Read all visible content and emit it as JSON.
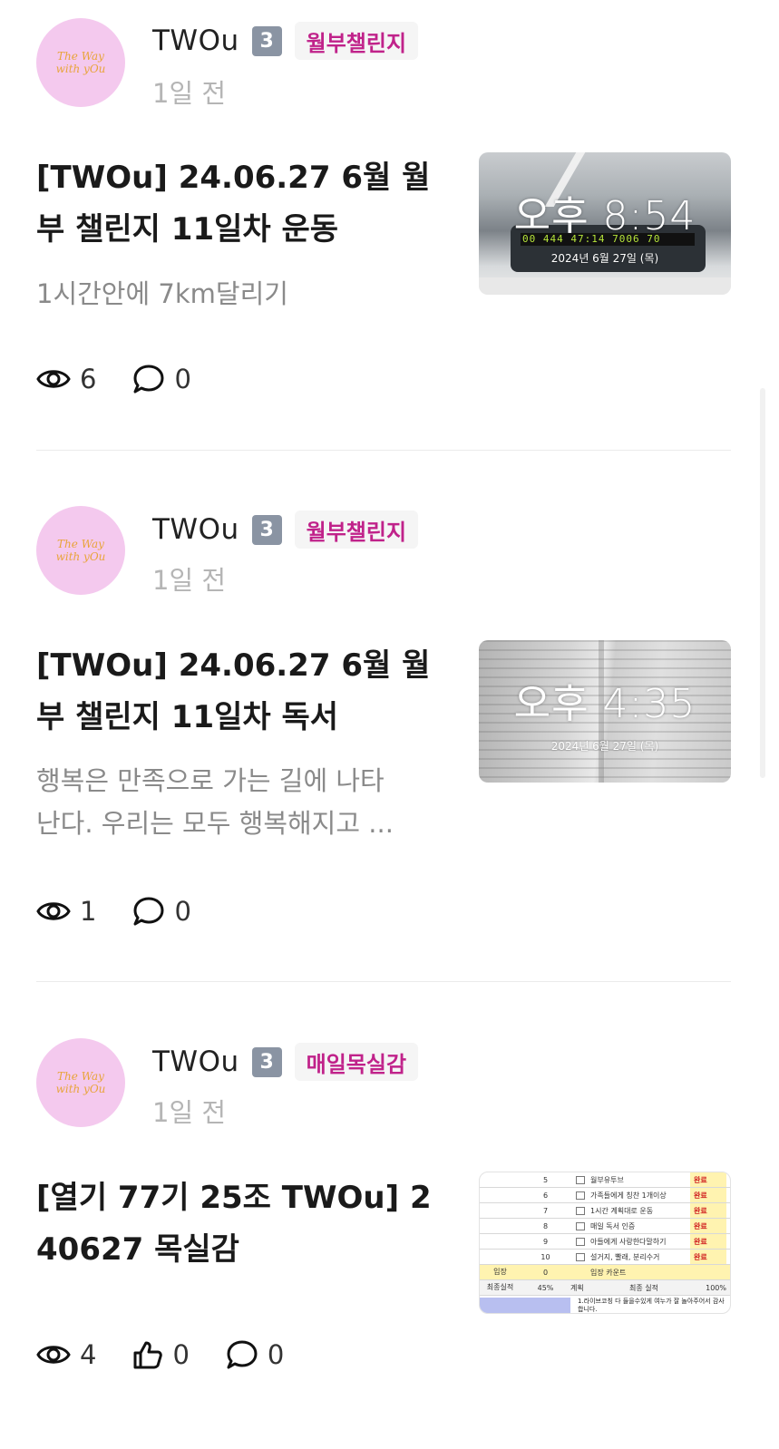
{
  "posts": [
    {
      "author": "TWOu",
      "level": "3",
      "category": "월부챌린지",
      "time": "1일 전",
      "title": "[TWOu] 24.06.27 6월 월\n부 챌린지 11일차 운동",
      "excerpt": "1시간안에 7km달리기",
      "views": "6",
      "comments": "0",
      "thumbnail": {
        "kind": "treadmill-photo",
        "clock": "오후 8:54",
        "date": "2024년 6월 27일 (목)",
        "digits": "00 444 47:14 7006 70"
      }
    },
    {
      "author": "TWOu",
      "level": "3",
      "category": "월부챌린지",
      "time": "1일 전",
      "title": "[TWOu] 24.06.27 6월 월\n부 챌린지 11일차 독서",
      "excerpt": "행복은 만족으로 가는 길에 나타\n난다. 우리는 모두 행복해지고 ...",
      "views": "1",
      "comments": "0",
      "thumbnail": {
        "kind": "book-photo",
        "clock": "오후 4:35",
        "date": "2024년 6월 27일 (목)"
      }
    },
    {
      "author": "TWOu",
      "level": "3",
      "category": "매일목실감",
      "time": "1일 전",
      "title": "[열기 77기 25조 TWOu] 2\n40627 목실감",
      "views": "4",
      "likes": "0",
      "comments": "0",
      "thumbnail": {
        "kind": "spreadsheet",
        "rows": [
          {
            "num": "5",
            "task": "월부유투브",
            "status": "완료"
          },
          {
            "num": "6",
            "task": "가족들에게 칭찬 1개이상",
            "status": "완료"
          },
          {
            "num": "7",
            "task": "1시간 계획대로 운동",
            "status": "완료"
          },
          {
            "num": "8",
            "task": "매일 독서 인증",
            "status": "완료"
          },
          {
            "num": "9",
            "task": "아들에게 사랑한다말하기",
            "status": "완료"
          },
          {
            "num": "10",
            "task": "설거지, 빨래, 분리수거",
            "status": "완료"
          }
        ],
        "summary1": {
          "a": "입장",
          "b": "0",
          "c": "입장 카운트"
        },
        "summary2": {
          "a": "최종실적",
          "b": "45%",
          "c": "계획",
          "d": "최종 실적",
          "e": "100%"
        },
        "note": "1.라이브코칭 다 들을수있게 여누가 잘 놀아주어서 감사합니다."
      }
    }
  ],
  "avatar_text": "The Way\nwith yOu",
  "colors": {
    "category": "#c0228a",
    "level_bg": "#8a94a3",
    "avatar_bg": "#f4c9ee"
  }
}
